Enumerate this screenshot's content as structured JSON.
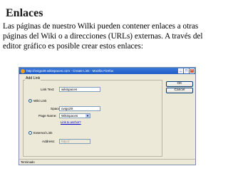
{
  "slide": {
    "title": "Enlaces",
    "body_lines": [
      "Las páginas de nuestro Wilki pueden contener enlaces a otras",
      "páginas del Wiki o a direcciones (URLs) externas. A través del",
      "editor gráfico es posible crear estos enlaces:"
    ]
  },
  "dialog": {
    "window_title": "http://ovigo29.wikispaces.com - Create Link - Mozilla Firefox",
    "add_link_legend": "Add Link",
    "link_text_label": "Link Text:",
    "link_text_value": "wikispaces",
    "wiki_link_label": "Wiki Link",
    "space_label": "Space:",
    "space_value": "ovigo29",
    "page_name_label": "Page Name:",
    "page_name_value": "Wikispaces",
    "link_to_anchor": "Link to anchor?",
    "external_link_label": "External Link",
    "address_label": "Address:",
    "address_value": "http://",
    "ok_label": "OK",
    "cancel_label": "Cancel",
    "status_text": "Terminado"
  }
}
